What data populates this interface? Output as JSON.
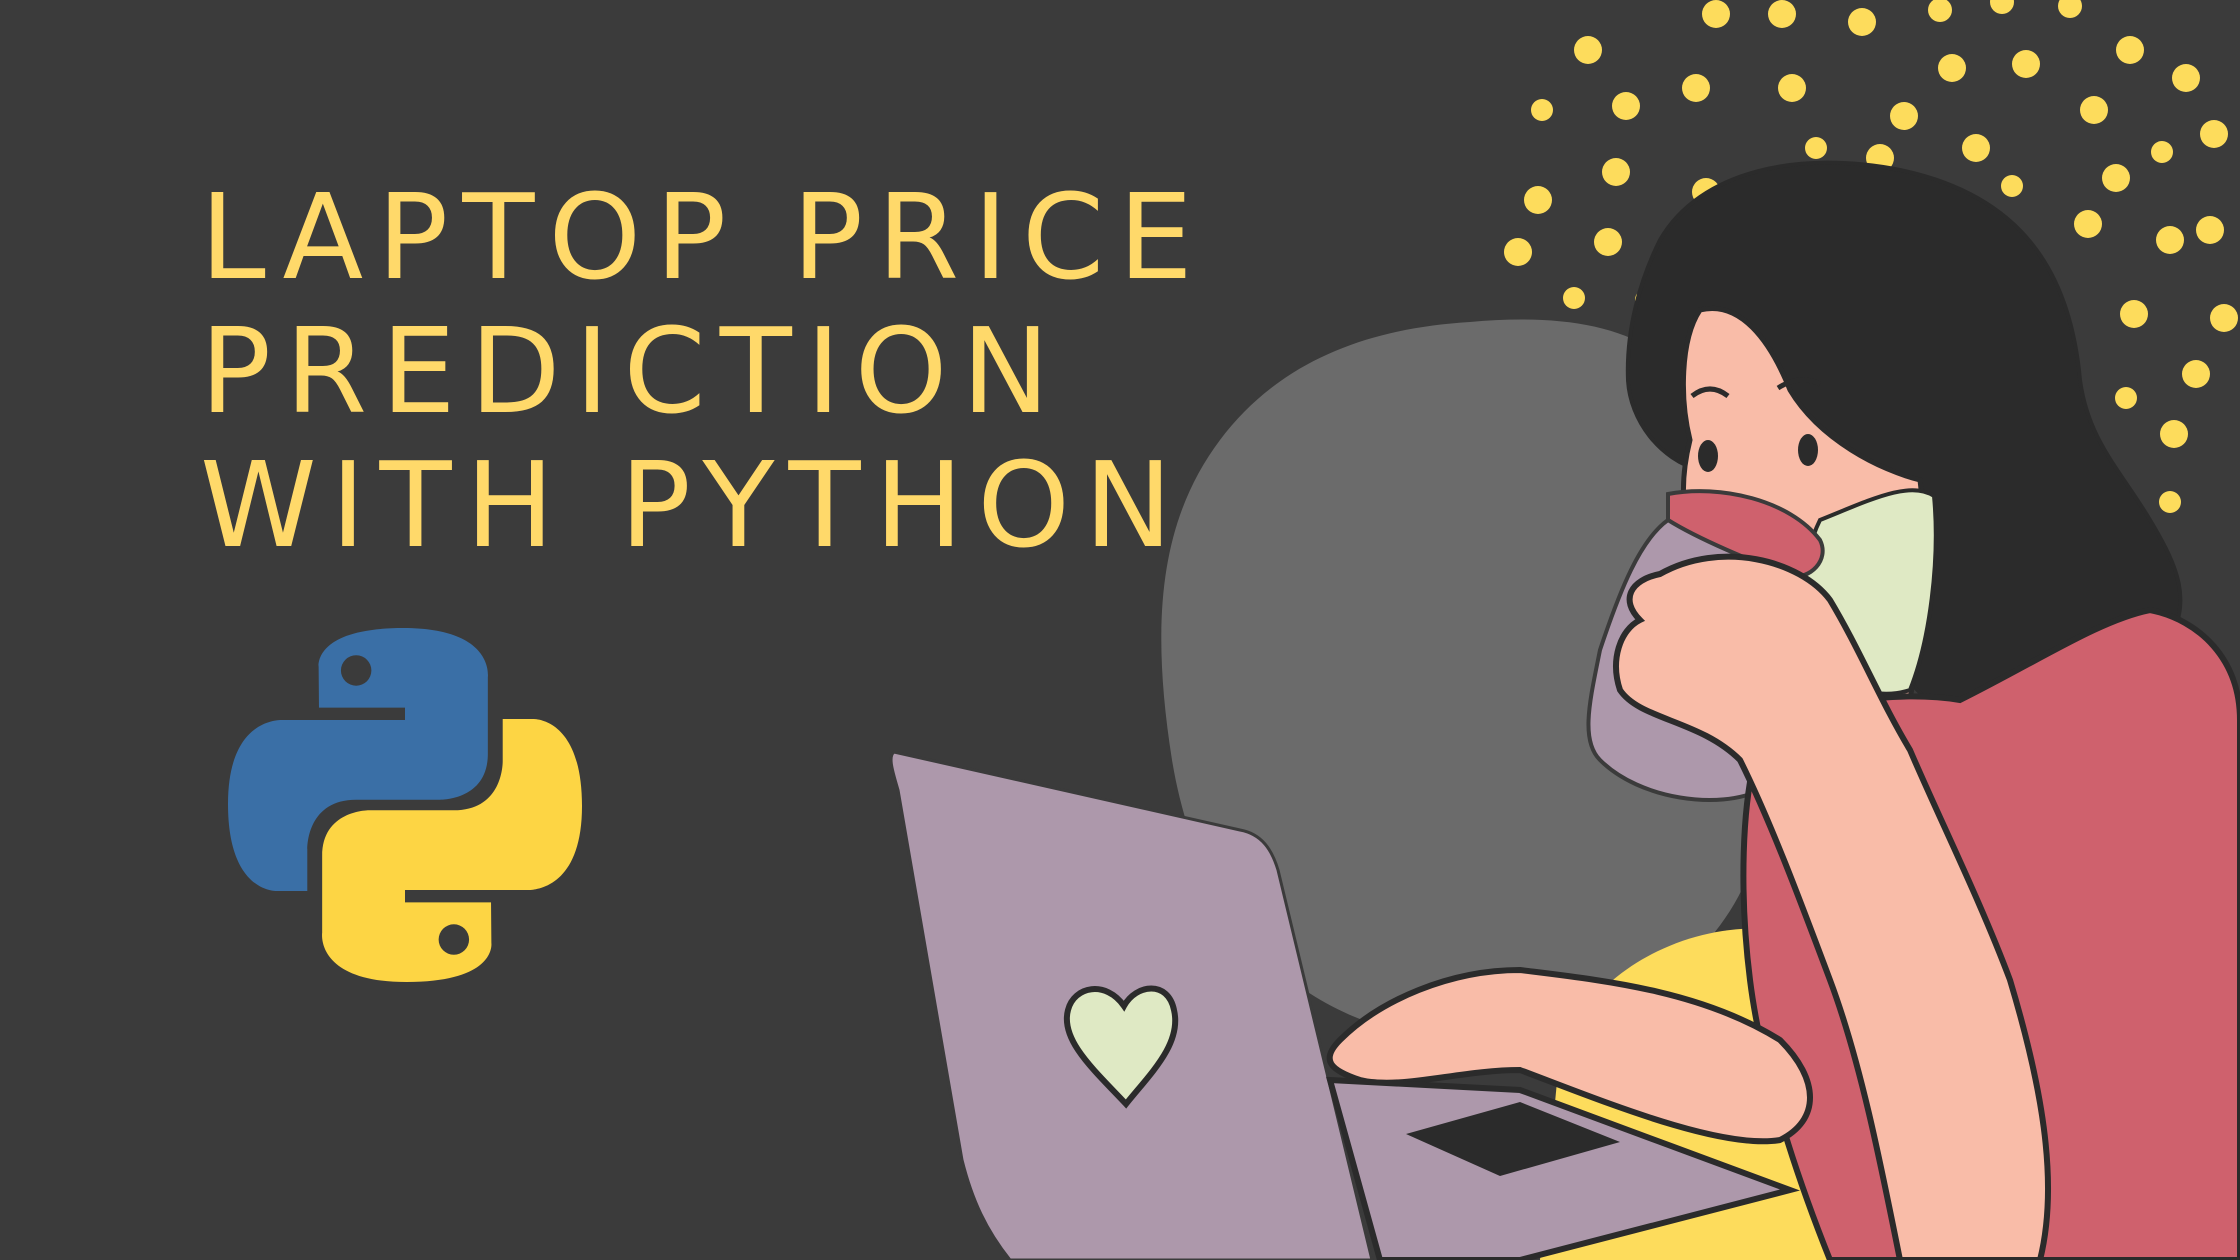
{
  "title": {
    "line1": "LAPTOP PRICE",
    "line2": "PREDICTION",
    "line3": "WITH PYTHON"
  },
  "colors": {
    "background": "#3b3b3b",
    "title": "#ffd96a",
    "dots": "#fddc5c",
    "python_blue": "#3a6fa6",
    "python_yellow": "#fdd544",
    "laptop": "#ad98ab",
    "shirt": "#cf616d",
    "skin": "#f9bca8",
    "hair": "#2b2b2b",
    "mask": "#dfe9c4",
    "blob": "#6b6b6b"
  },
  "icons": {
    "logo": "python-logo-icon",
    "laptop": "laptop-icon",
    "heart": "heart-icon"
  }
}
